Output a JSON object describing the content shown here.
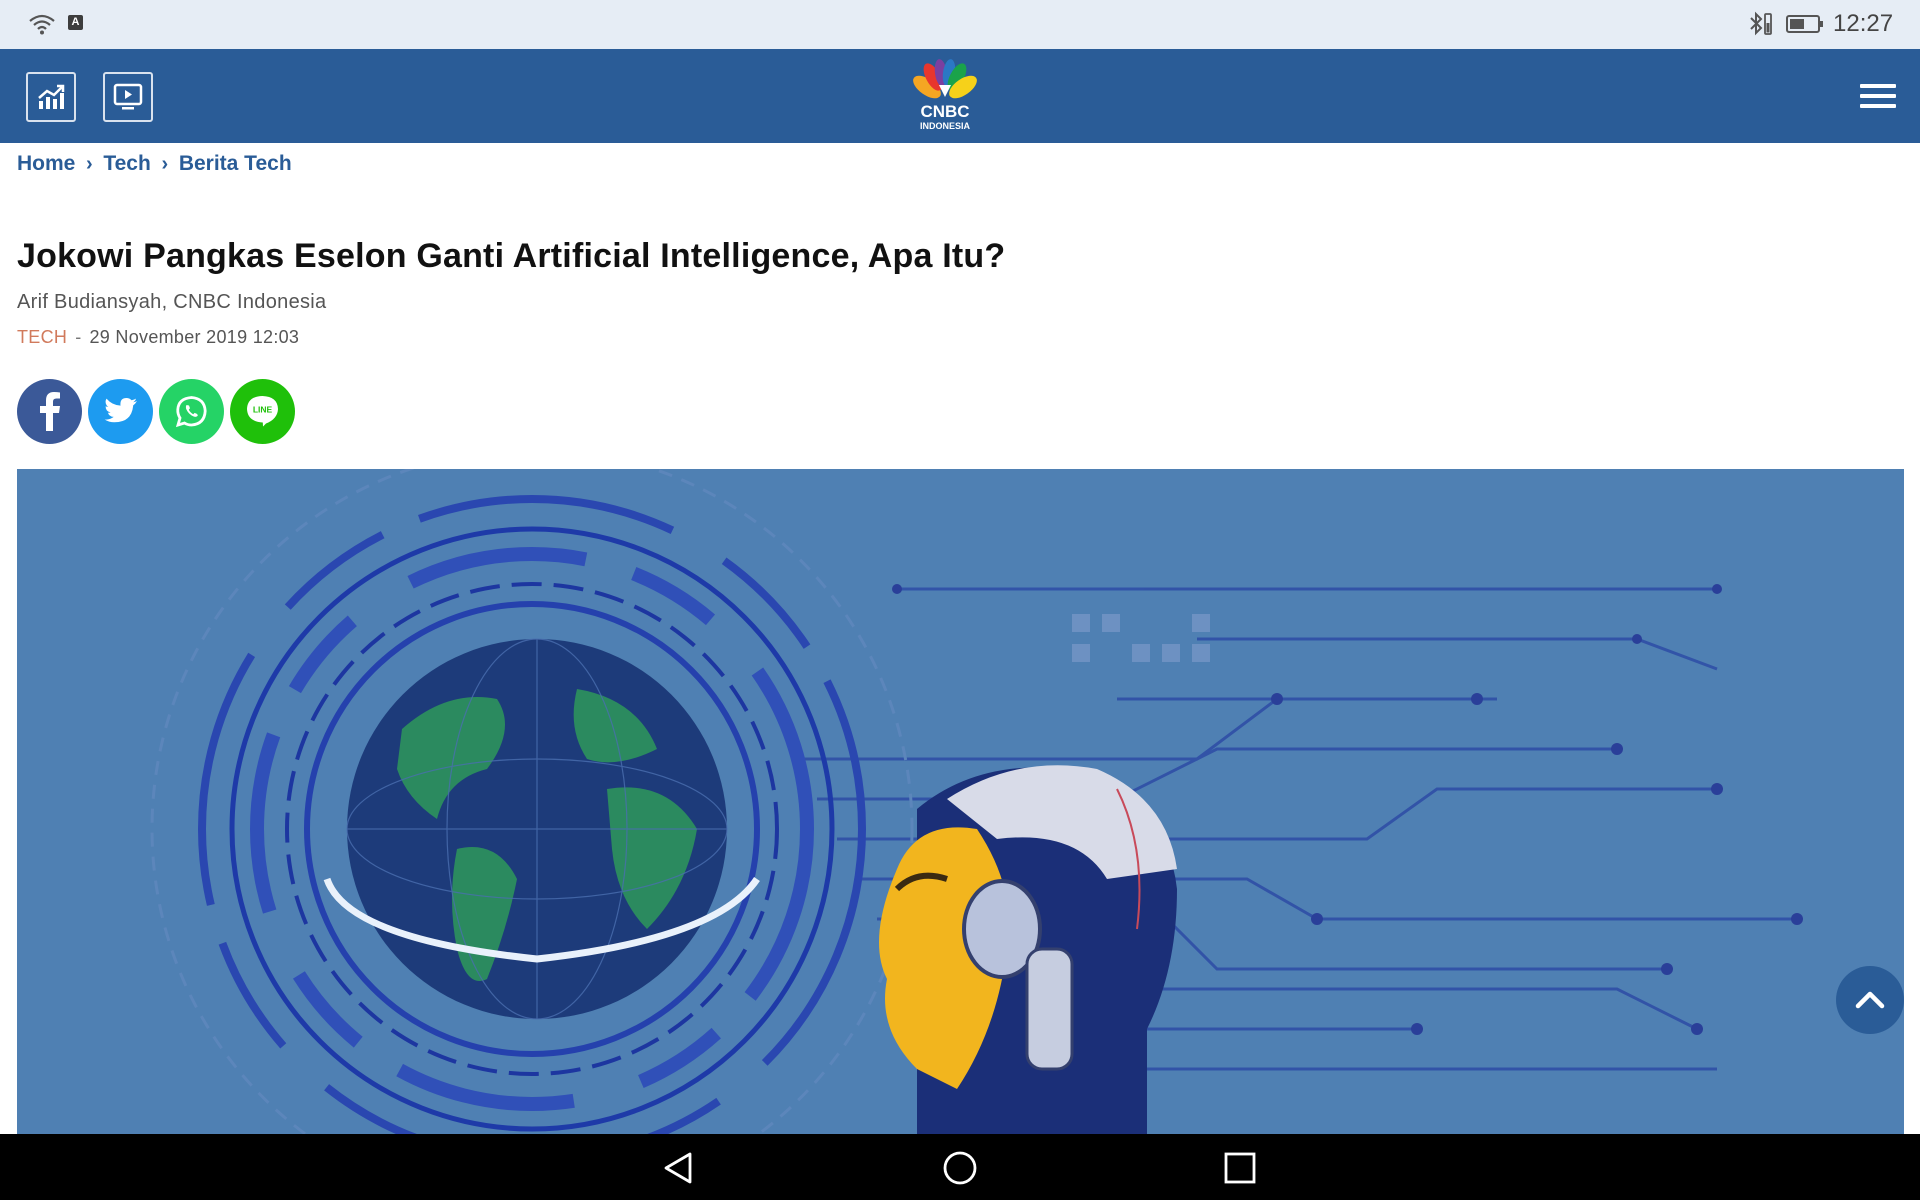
{
  "status_bar": {
    "time": "12:27",
    "icons": [
      "wifi-icon",
      "a-badge-icon",
      "bluetooth-icon",
      "battery-icon"
    ],
    "a_badge": "A"
  },
  "header": {
    "left_buttons": [
      "market-chart-icon",
      "tv-play-icon"
    ],
    "logo_text": "CNBC",
    "logo_subtext": "INDONESIA",
    "menu_icon": "hamburger-menu-icon",
    "background": "#2a5c97"
  },
  "breadcrumb": {
    "items": [
      "Home",
      "Tech",
      "Berita Tech"
    ]
  },
  "article": {
    "title": "Jokowi Pangkas Eselon Ganti Artificial Intelligence, Apa Itu?",
    "author": "Arif Budiansyah, CNBC Indonesia",
    "category": "TECH",
    "date": "29 November 2019 12:03"
  },
  "share": {
    "buttons": [
      {
        "name": "facebook",
        "color": "#3b5998"
      },
      {
        "name": "twitter",
        "color": "#1d9bf0"
      },
      {
        "name": "whatsapp",
        "color": "#25d366"
      },
      {
        "name": "line",
        "color": "#1fc00a"
      }
    ],
    "line_label": "LINE"
  },
  "hero": {
    "description_icon": "ai-robot-globe-illustration"
  },
  "navbar": {
    "icons": [
      "back-icon",
      "home-icon",
      "recents-icon"
    ]
  }
}
